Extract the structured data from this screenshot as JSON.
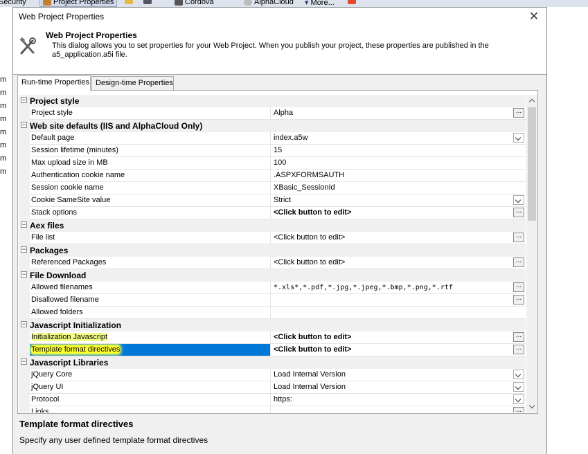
{
  "background": {
    "taskbar": {
      "security": "Security",
      "project_properties": "Project Properties",
      "cordova": "Cordova",
      "alphacloud": "AlphaCloud",
      "more": "More..."
    },
    "left_letters": [
      "m",
      "m",
      "m",
      "m",
      "m",
      "m",
      "m",
      "m"
    ]
  },
  "dialog": {
    "title": "Web Project Properties",
    "close_label": "✕",
    "header_title": "Web Project Properties",
    "header_desc": "This dialog allows you to set properties for your Web Project. When you publish your project, these properties are published in the a5_application.a5i file.",
    "tabs": [
      {
        "label": "Run-time Properties",
        "active": true
      },
      {
        "label": "Design-time Properties",
        "active": false
      }
    ],
    "grid": {
      "categories": [
        {
          "label": "Project style",
          "rows": [
            {
              "name": "Project style",
              "value": "Alpha",
              "button": "edit"
            }
          ]
        },
        {
          "label": "Web site defaults (IIS and AlphaCloud Only)",
          "rows": [
            {
              "name": "Default page",
              "value": "index.a5w",
              "button": "dropdown"
            },
            {
              "name": "Session lifetime (minutes)",
              "value": "15"
            },
            {
              "name": "Max upload size in MB",
              "value": "100"
            },
            {
              "name": "Authentication cookie name",
              "value": ".ASPXFORMSAUTH"
            },
            {
              "name": "Session cookie name",
              "value": "XBasic_SessionId"
            },
            {
              "name": "Cookie SameSite value",
              "value": "Strict",
              "button": "dropdown"
            },
            {
              "name": "Stack options",
              "value": "<Click button to edit>",
              "bold": true,
              "button": "edit"
            }
          ]
        },
        {
          "label": "Aex files",
          "rows": [
            {
              "name": "File list",
              "value": "<Click button to edit>",
              "button": "edit"
            }
          ]
        },
        {
          "label": "Packages",
          "rows": [
            {
              "name": "Referenced Packages",
              "value": "<Click button to edit>",
              "button": "edit"
            }
          ]
        },
        {
          "label": "File Download",
          "rows": [
            {
              "name": "Allowed filenames",
              "value": "*.xls*,*.pdf,*.jpg,*.jpeg,*.bmp,*.png,*.rtf",
              "mono": true,
              "button": "edit"
            },
            {
              "name": "Disallowed filename",
              "value": "",
              "button": "edit"
            },
            {
              "name": "Allowed folders",
              "value": ""
            }
          ]
        },
        {
          "label": "Javascript Initialization",
          "rows": [
            {
              "name": "Initialization Javascript",
              "value": "<Click button to edit>",
              "bold": true,
              "button": "edit",
              "soft_highlight": true
            },
            {
              "name": "Template format directives",
              "value": "<Click button to edit>",
              "bold": true,
              "button": "edit",
              "selected": true
            }
          ]
        },
        {
          "label": "Javascript Libraries",
          "rows": [
            {
              "name": "jQuery Core",
              "value": "Load Internal Version",
              "button": "dropdown"
            },
            {
              "name": "jQuery UI",
              "value": "Load Internal Version",
              "button": "dropdown"
            },
            {
              "name": "Protocol",
              "value": "https:",
              "button": "dropdown"
            },
            {
              "name": "Links",
              "value": "",
              "button": "edit"
            }
          ]
        }
      ]
    },
    "description": {
      "title": "Template format directives",
      "text": "Specify any user defined template format directives"
    },
    "colors": {
      "selection": "#0078d7",
      "highlight": "#ffff33"
    }
  }
}
